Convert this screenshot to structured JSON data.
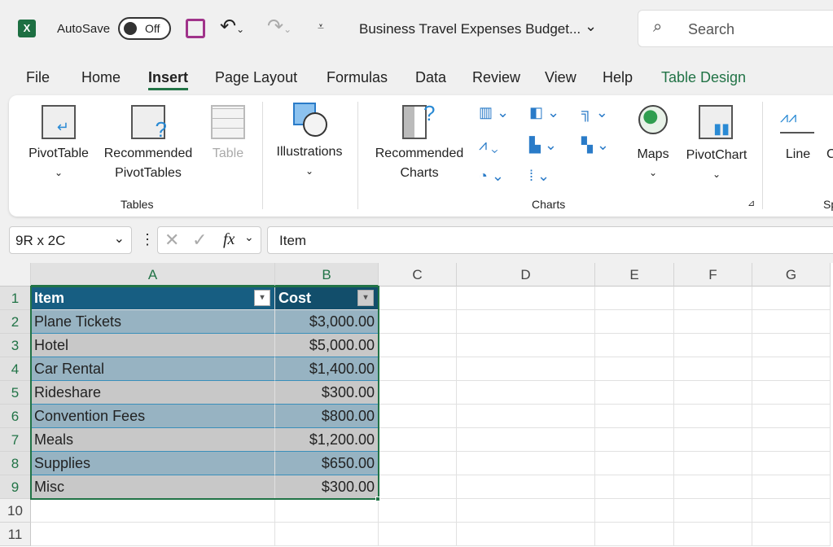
{
  "titlebar": {
    "autosave": "AutoSave",
    "toggle": "Off",
    "filename": "Business Travel Expenses Budget...",
    "search": "Search"
  },
  "tabs": [
    "File",
    "Home",
    "Insert",
    "Page Layout",
    "Formulas",
    "Data",
    "Review",
    "View",
    "Help",
    "Table Design"
  ],
  "active_tab": "Insert",
  "ribbon": {
    "pivottable": "PivotTable",
    "rec_pivot1": "Recommended",
    "rec_pivot2": "PivotTables",
    "table": "Table",
    "tables_group": "Tables",
    "illustrations": "Illustrations",
    "rec_charts1": "Recommended",
    "rec_charts2": "Charts",
    "charts_group": "Charts",
    "maps": "Maps",
    "pivotchart": "PivotChart",
    "line": "Line",
    "cut_c": "C",
    "cut_sp": "Sp"
  },
  "formula_bar": {
    "name_box": "9R x 2C",
    "fx": "fx",
    "value": "Item"
  },
  "columns": [
    "A",
    "B",
    "C",
    "D",
    "E",
    "F",
    "G"
  ],
  "rows": [
    "1",
    "2",
    "3",
    "4",
    "5",
    "6",
    "7",
    "8",
    "9",
    "10",
    "11"
  ],
  "table": {
    "headers": [
      "Item",
      "Cost"
    ],
    "rows": [
      [
        "Plane Tickets",
        "$3,000.00"
      ],
      [
        "Hotel",
        "$5,000.00"
      ],
      [
        "Car Rental",
        "$1,400.00"
      ],
      [
        "Rideshare",
        "$300.00"
      ],
      [
        "Convention Fees",
        "$800.00"
      ],
      [
        "Meals",
        "$1,200.00"
      ],
      [
        "Supplies",
        "$650.00"
      ],
      [
        "Misc",
        "$300.00"
      ]
    ]
  },
  "colors": {
    "accent": "#217346",
    "table_header": "#175e82",
    "band1": "#97b3c2",
    "band2": "#c8c8c8"
  }
}
